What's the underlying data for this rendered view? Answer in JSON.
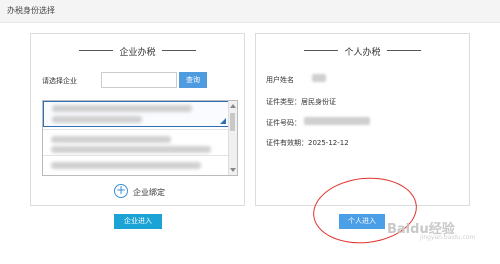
{
  "header": {
    "title": "办税身份选择"
  },
  "enterprise": {
    "title": "企业办税",
    "select_label": "请选择企业",
    "search_placeholder": "",
    "search_button": "查询",
    "bind_label": "企业绑定",
    "enter_button": "企业进入"
  },
  "personal": {
    "title": "个人办税",
    "user_name_label": "用户姓名",
    "cert_type": "证件类型：居民身份证",
    "cert_no_label": "证件号码：",
    "validity": "证件有效期：2025-12-12",
    "enter_button": "个人进入"
  },
  "watermark": {
    "text": "Baidu经验",
    "sub": "jingyan.baidu.com"
  },
  "icons": {
    "add": "plus-circle-icon",
    "scroll_up": "arrow-up-icon",
    "scroll_down": "arrow-down-icon"
  },
  "colors": {
    "accent": "#4e9be0",
    "enter_button": "#1ba3d6",
    "annotation": "#e0322c"
  }
}
